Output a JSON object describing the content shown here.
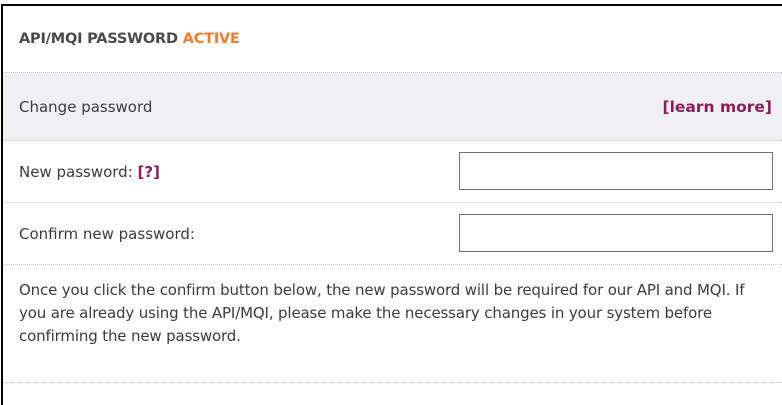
{
  "header": {
    "title": "API/MQI PASSWORD",
    "status": "ACTIVE"
  },
  "section": {
    "title": "Change password",
    "learn_more": "[learn more]"
  },
  "fields": {
    "new_password": {
      "label": "New password:",
      "help": "[?]",
      "value": ""
    },
    "confirm_password": {
      "label": "Confirm new password:",
      "value": ""
    }
  },
  "notice": {
    "text": "Once you click the confirm button below, the new password will be required for our API and MQI. If you are already using the API/MQI, please make the necessary changes in your system before confirming the new password."
  },
  "colors": {
    "status_active": "#f07b2b",
    "link": "#8b1e5a",
    "section_bg": "#f0f0f2",
    "text": "#3c3c3c"
  }
}
